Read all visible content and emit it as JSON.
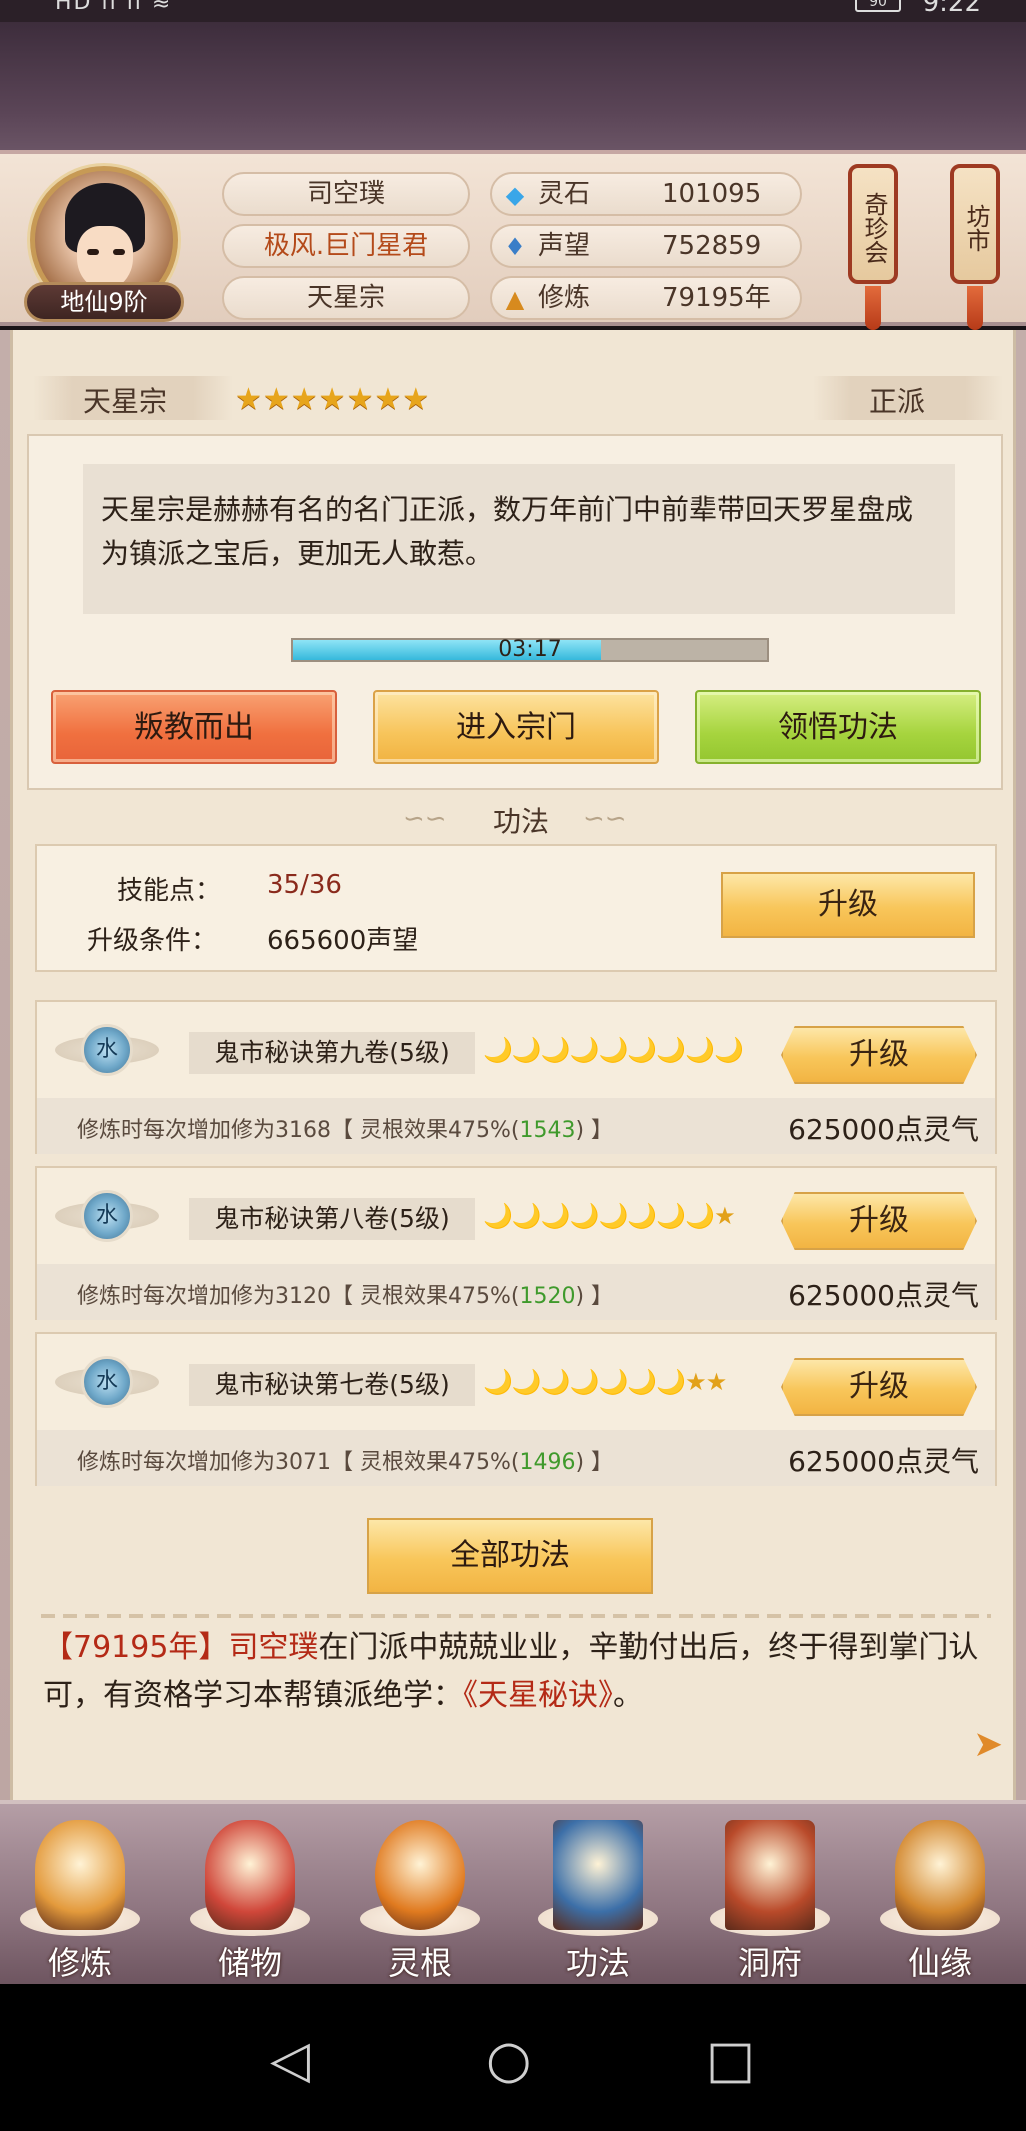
{
  "status_bar": {
    "left": "HD ıı ıı ≋",
    "battery": "90",
    "time": "9:22"
  },
  "player": {
    "name": "司空璞",
    "title": "极风.巨门星君",
    "sect": "天星宗",
    "rank": "地仙9阶"
  },
  "stats": [
    {
      "icon": "spirit-stone-icon",
      "label": "灵石",
      "value": "101095"
    },
    {
      "icon": "reputation-icon",
      "label": "声望",
      "value": "752859"
    },
    {
      "icon": "cultivation-icon",
      "label": "修炼",
      "value": "79195年"
    }
  ],
  "side_buttons": {
    "treasure": "奇珍会",
    "market": "坊市"
  },
  "sect_info": {
    "name": "天星宗",
    "star_count": 7,
    "alignment": "正派",
    "description": "天星宗是赫赫有名的名门正派，数万年前门中前辈带回天罗星盘成为镇派之宝后，更加无人敢惹。",
    "timer": "03:17",
    "timer_progress": 0.65
  },
  "actions": {
    "leave": "叛教而出",
    "enter": "进入宗门",
    "learn": "领悟功法"
  },
  "technique_section": {
    "title": "功法",
    "skill_points_label": "技能点：",
    "skill_points": "35/36",
    "condition_label": "升级条件：",
    "condition": "665600声望",
    "upgrade": "升级"
  },
  "techniques": [
    {
      "element": "水",
      "name": "鬼市秘诀第九卷(5级)",
      "rating": "🌙🌙🌙🌙🌙🌙🌙🌙🌙",
      "effect_prefix": "修炼时每次增加修为3168【 灵根效果475%(",
      "effect_bonus": "1543",
      "effect_suffix": ") 】",
      "cost": "625000点灵气",
      "upgrade": "升级"
    },
    {
      "element": "水",
      "name": "鬼市秘诀第八卷(5级)",
      "rating": "🌙🌙🌙🌙🌙🌙🌙🌙★",
      "effect_prefix": "修炼时每次增加修为3120【 灵根效果475%(",
      "effect_bonus": "1520",
      "effect_suffix": ") 】",
      "cost": "625000点灵气",
      "upgrade": "升级"
    },
    {
      "element": "水",
      "name": "鬼市秘诀第七卷(5级)",
      "rating": "🌙🌙🌙🌙🌙🌙🌙★★",
      "effect_prefix": "修炼时每次增加修为3071【 灵根效果475%(",
      "effect_bonus": "1496",
      "effect_suffix": ") 】",
      "cost": "625000点灵气",
      "upgrade": "升级"
    }
  ],
  "all_techniques": "全部功法",
  "news": {
    "year": "【79195年】",
    "name": "司空璞",
    "text1": "在门派中兢兢业业，辛勤付出后，终于得到掌门认可，有资格学习本帮镇派绝学：",
    "skill": "《天星秘诀》",
    "text2": "。"
  },
  "nav": [
    {
      "icon": "cultivate-icon",
      "label": "修炼",
      "color": "#e39a3c"
    },
    {
      "icon": "storage-bag-icon",
      "label": "储物",
      "color": "#d0473a"
    },
    {
      "icon": "spirit-root-icon",
      "label": "灵根",
      "color": "#e07a1f"
    },
    {
      "icon": "technique-book-icon",
      "label": "功法",
      "color": "#3c6fa8"
    },
    {
      "icon": "cave-residence-icon",
      "label": "洞府",
      "color": "#b94a2a"
    },
    {
      "icon": "fate-gourd-icon",
      "label": "仙缘",
      "color": "#d2872e"
    }
  ]
}
